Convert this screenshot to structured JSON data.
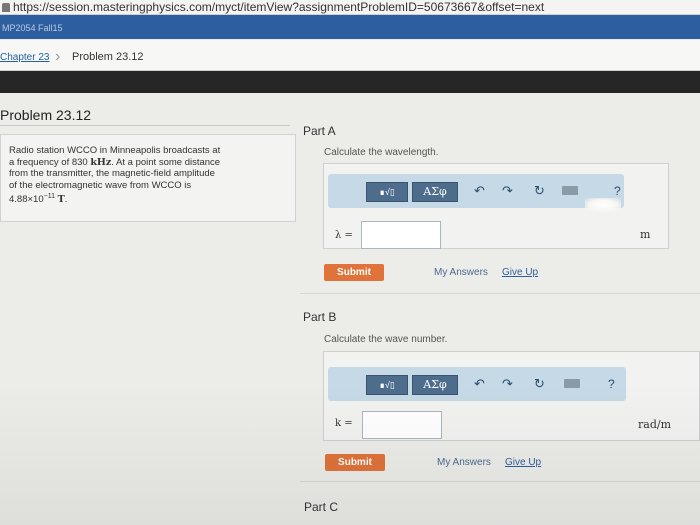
{
  "browser": {
    "url": "https://session.masteringphysics.com/myct/itemView?assignmentProblemID=50673667&offset=next"
  },
  "course": {
    "name": "MP2054 Fall15"
  },
  "breadcrumb": {
    "chapter": "Chapter 23",
    "current": "Problem 23.12"
  },
  "problem": {
    "title": "Problem 23.12",
    "statement_line1": "Radio station WCCO in Minneapolis broadcasts at",
    "statement_line2_pre": "a frequency of 830 ",
    "statement_freq_unit": "kHz",
    "statement_line2_post": ". At a point some distance",
    "statement_line3": "from the transmitter, the magnetic-field amplitude",
    "statement_line4": "of the electromagnetic wave from WCCO is",
    "amplitude_base": "4.88×10",
    "amplitude_exp": "−11",
    "amplitude_unit": "T",
    "statement_end": "."
  },
  "toolbar": {
    "templates_label": "∎√▯",
    "symbols_label": "ΑΣφ",
    "undo_icon": "↶",
    "redo_icon": "↷",
    "reset_icon": "↻",
    "help_label": "?"
  },
  "parts": [
    {
      "header": "Part A",
      "instruction": "Calculate the wavelength.",
      "variable": "λ =",
      "answer": "",
      "unit": "m",
      "submit": "Submit",
      "my_answers": "My Answers",
      "give_up": "Give Up"
    },
    {
      "header": "Part B",
      "instruction": "Calculate the wave number.",
      "variable": "k =",
      "answer": "",
      "unit": "rad/m",
      "submit": "Submit",
      "my_answers": "My Answers",
      "give_up": "Give Up"
    },
    {
      "header": "Part C"
    }
  ],
  "colors": {
    "course_bar": "#2d5fa0",
    "submit": "#e0733a",
    "toolbar": "#c5d9e6",
    "link": "#2e5f9c"
  }
}
